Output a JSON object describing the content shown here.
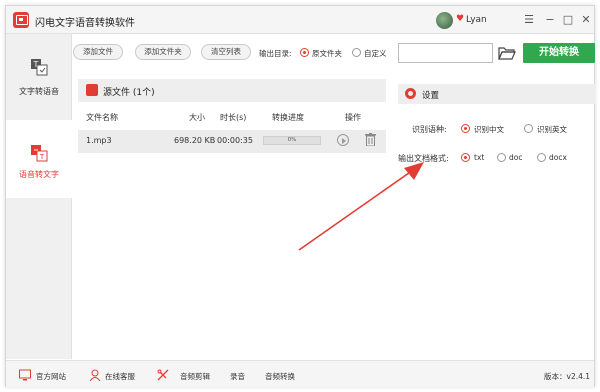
{
  "app": {
    "title": "闪电文字语音转换软件",
    "username": "Lyan"
  },
  "window_controls": {
    "menu": "☰",
    "minimize": "−",
    "maximize": "□",
    "close": "✕"
  },
  "sidebar": {
    "items": [
      {
        "label": "文字转语音",
        "active": false
      },
      {
        "label": "语音转文字",
        "active": true
      }
    ]
  },
  "toolbar": {
    "add_file": "添加文件",
    "add_folder": "添加文件夹",
    "clear_list": "清空列表",
    "output_label": "输出目录:",
    "output_options": [
      "原文件夹",
      "自定义"
    ],
    "output_selected": "原文件夹",
    "path_value": "",
    "start_button": "开始转换"
  },
  "file_panel": {
    "title": "源文件 (1个)",
    "columns": [
      "文件名称",
      "大小",
      "时长(s)",
      "转换进度",
      "操作"
    ],
    "rows": [
      {
        "name": "1.mp3",
        "size": "698.20 KB",
        "duration": "00:00:35",
        "progress": "0%",
        "progress_value": 0
      }
    ]
  },
  "settings": {
    "title": "设置",
    "language_label": "识别语种:",
    "language_options": [
      "识别中文",
      "识别英文"
    ],
    "language_selected": "识别中文",
    "format_label": "输出文档格式:",
    "format_options": [
      "txt",
      "doc",
      "docx"
    ],
    "format_selected": "txt"
  },
  "statusbar": {
    "items": [
      "官方网站",
      "在线客服",
      "音频剪辑",
      "录音",
      "音频转换"
    ],
    "version": "版本：v2.4.1"
  },
  "colors": {
    "accent": "#e23d35",
    "start_green": "#2fa84f",
    "annotation_arrow": "#e23d35"
  },
  "icons": [
    "logo-icon",
    "avatar-icon",
    "heart-icon",
    "text-to-speech-icon",
    "speech-to-text-icon",
    "source-file-icon",
    "play-icon",
    "trash-icon",
    "gear-icon",
    "folder-open-icon",
    "website-icon",
    "support-icon",
    "audio-edit-icon"
  ]
}
